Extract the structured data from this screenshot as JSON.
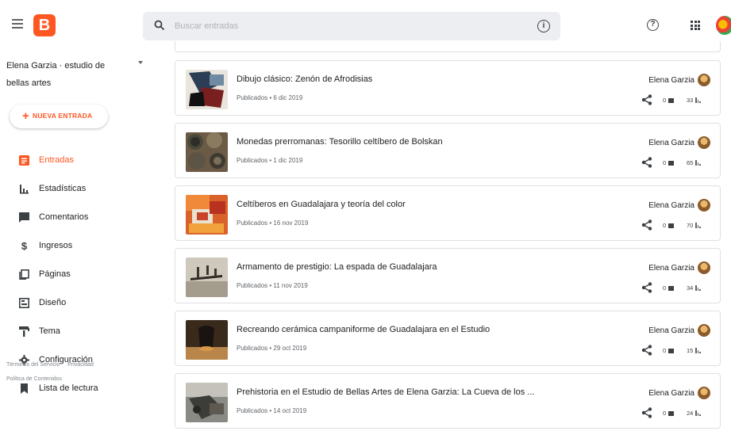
{
  "header": {
    "search_placeholder": "Buscar entradas"
  },
  "sidebar": {
    "blog_name": "Elena Garzia · estudio de bellas artes",
    "new_post_label": "NUEVA ENTRADA",
    "items": [
      {
        "label": "Entradas",
        "icon": "posts-icon",
        "active": true
      },
      {
        "label": "Estadísticas",
        "icon": "stats-icon"
      },
      {
        "label": "Comentarios",
        "icon": "comments-icon"
      },
      {
        "label": "Ingresos",
        "icon": "dollar-icon"
      },
      {
        "label": "Páginas",
        "icon": "pages-icon"
      },
      {
        "label": "Diseño",
        "icon": "layout-icon"
      },
      {
        "label": "Tema",
        "icon": "theme-icon"
      },
      {
        "label": "Configuración",
        "icon": "gear-icon"
      },
      {
        "label": "Lista de lectura",
        "icon": "bookmark-icon"
      }
    ],
    "footer": {
      "terms": "Términos del Servicio",
      "privacy": "Privacidad",
      "content_policy": "Política de Contenidos"
    }
  },
  "posts": [
    {
      "title": "Dibujo clásico: Zenón de Afrodisias",
      "meta": "Publicados • 6 dic 2019",
      "author": "Elena Garzia",
      "comments": "0",
      "views": "33",
      "thumb": "drawing"
    },
    {
      "title": "Monedas prerromanas: Tesorillo celtíbero de Bolskan",
      "meta": "Publicados • 1 dic 2019",
      "author": "Elena Garzia",
      "comments": "0",
      "views": "65",
      "thumb": "coins"
    },
    {
      "title": "Celtíberos en Guadalajara y teoría del color",
      "meta": "Publicados • 16 nov 2019",
      "author": "Elena Garzia",
      "comments": "0",
      "views": "70",
      "thumb": "color"
    },
    {
      "title": "Armamento de prestigio: La espada de Guadalajara",
      "meta": "Publicados • 11 nov 2019",
      "author": "Elena Garzia",
      "comments": "0",
      "views": "34",
      "thumb": "sword"
    },
    {
      "title": "Recreando cerámica campaniforme de Guadalajara en el Estudio",
      "meta": "Publicados • 29 oct 2019",
      "author": "Elena Garzia",
      "comments": "0",
      "views": "15",
      "thumb": "ceramic"
    },
    {
      "title": "Prehistoria en el Estudio de Bellas Artes de Elena Garzia: La Cueva de los ...",
      "meta": "Publicados • 14 oct 2019",
      "author": "Elena Garzia",
      "comments": "0",
      "views": "24",
      "thumb": "cave"
    }
  ],
  "colors": {
    "accent": "#ff5722",
    "search_bg": "#eceef1",
    "border": "#e0e0e0"
  }
}
